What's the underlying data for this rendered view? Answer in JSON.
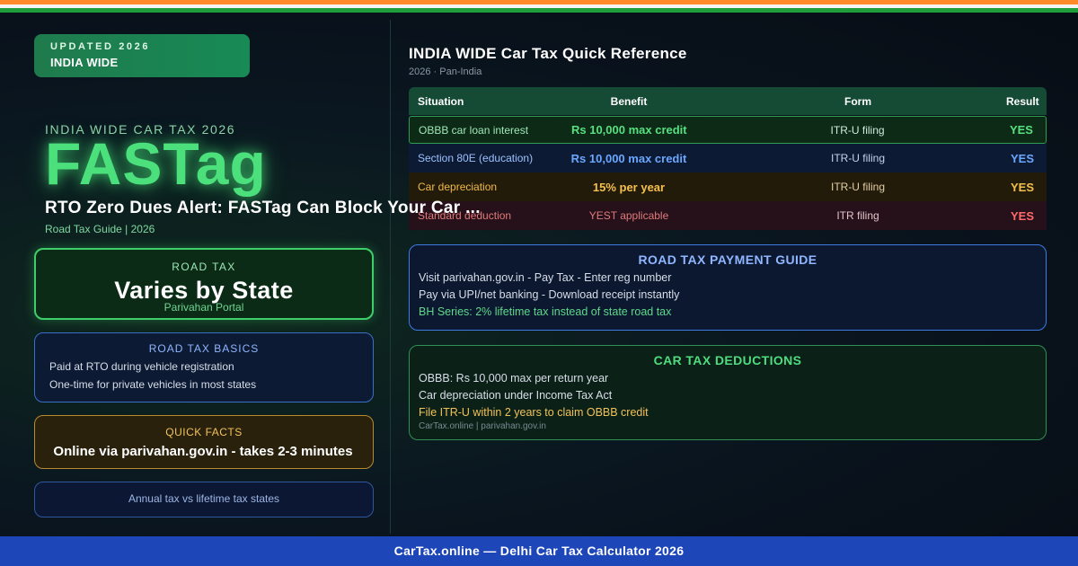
{
  "badge": {
    "line1": "UPDATED 2026",
    "line2": "INDIA WIDE"
  },
  "hero": {
    "kicker": "INDIA WIDE CAR TAX 2026",
    "title": "FASTag",
    "headline": "RTO Zero Dues Alert: FASTag Can Block Your Car ...",
    "subline": "Road Tax Guide | 2026"
  },
  "road_tax_card": {
    "label": "ROAD TAX",
    "value": "Varies by State",
    "note": "Parivahan Portal"
  },
  "basics_card": {
    "title": "ROAD TAX BASICS",
    "lines": [
      "Paid at RTO during vehicle registration",
      "One-time for private vehicles in most states"
    ]
  },
  "facts_card": {
    "title": "QUICK FACTS",
    "text": "Online via parivahan.gov.in - takes 2-3 minutes"
  },
  "annual_card": {
    "text": "Annual tax vs lifetime tax states"
  },
  "reference": {
    "title": "INDIA WIDE Car Tax Quick Reference",
    "subtitle": "2026 · Pan-India",
    "headers": [
      "Situation",
      "Benefit",
      "Form",
      "Result"
    ],
    "rows": [
      {
        "situation": "OBBB car loan interest",
        "benefit": "Rs 10,000 max credit",
        "form": "ITR-U filing",
        "result": "YES"
      },
      {
        "situation": "Section 80E (education)",
        "benefit": "Rs 10,000 max credit",
        "form": "ITR-U filing",
        "result": "YES"
      },
      {
        "situation": "Car depreciation",
        "benefit": "15% per year",
        "form": "ITR-U filing",
        "result": "YES"
      },
      {
        "situation": "Standard deduction",
        "benefit": "YEST applicable",
        "form": "ITR filing",
        "result": "YES"
      }
    ]
  },
  "payment_guide": {
    "title": "ROAD TAX PAYMENT GUIDE",
    "lines": [
      "Visit parivahan.gov.in - Pay Tax - Enter reg number",
      "Pay via UPI/net banking - Download receipt instantly",
      "BH Series: 2% lifetime tax instead of state road tax"
    ]
  },
  "deductions": {
    "title": "CAR TAX DEDUCTIONS",
    "lines": [
      "OBBB: Rs 10,000 max per return year",
      "Car depreciation under Income Tax Act",
      "File ITR-U within 2 years to claim OBBB credit"
    ],
    "source": "CarTax.online | parivahan.gov.in"
  },
  "footer": {
    "text": "CarTax.online — Delhi Car Tax Calculator 2026"
  },
  "colors": {
    "saffron": "#ff8a2a",
    "india_green": "#1f9d3a",
    "accent_green": "#4be07c",
    "accent_blue": "#6aa7ff",
    "accent_amber": "#f4c04d",
    "accent_red": "#ff6b6b",
    "footer_blue": "#1d46b8"
  }
}
